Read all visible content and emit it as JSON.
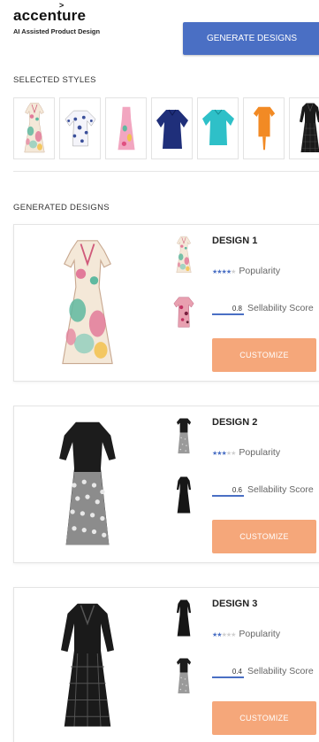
{
  "header": {
    "logo": "accenture",
    "logo_mark": ">",
    "tagline": "AI Assisted Product Design",
    "generate_button": "GENERATE DESIGNS"
  },
  "selected_styles": {
    "label": "SELECTED STYLES",
    "items": [
      {
        "icon": "floral-wrap-dress"
      },
      {
        "icon": "white-print-top"
      },
      {
        "icon": "pink-floral-dress"
      },
      {
        "icon": "navy-tunic"
      },
      {
        "icon": "turquoise-top"
      },
      {
        "icon": "orange-top"
      },
      {
        "icon": "black-lace-dress"
      }
    ]
  },
  "generated": {
    "label": "GENERATED DESIGNS",
    "designs": [
      {
        "title": "DESIGN 1",
        "popularity_stars": 4,
        "popularity_label": "Popularity",
        "sellability": "0.8",
        "sellability_label": "Sellability Score",
        "customize": "CUSTOMIZE"
      },
      {
        "title": "DESIGN 2",
        "popularity_stars": 3,
        "popularity_label": "Popularity",
        "sellability": "0.6",
        "sellability_label": "Sellability Score",
        "customize": "CUSTOMIZE"
      },
      {
        "title": "DESIGN 3",
        "popularity_stars": 2,
        "popularity_label": "Popularity",
        "sellability": "0.4",
        "sellability_label": "Sellability Score",
        "customize": "CUSTOMIZE"
      }
    ]
  },
  "colors": {
    "accent_blue": "#4a6fc4",
    "customize_orange": "#f5a77a",
    "star_off": "#cfcfcf"
  }
}
